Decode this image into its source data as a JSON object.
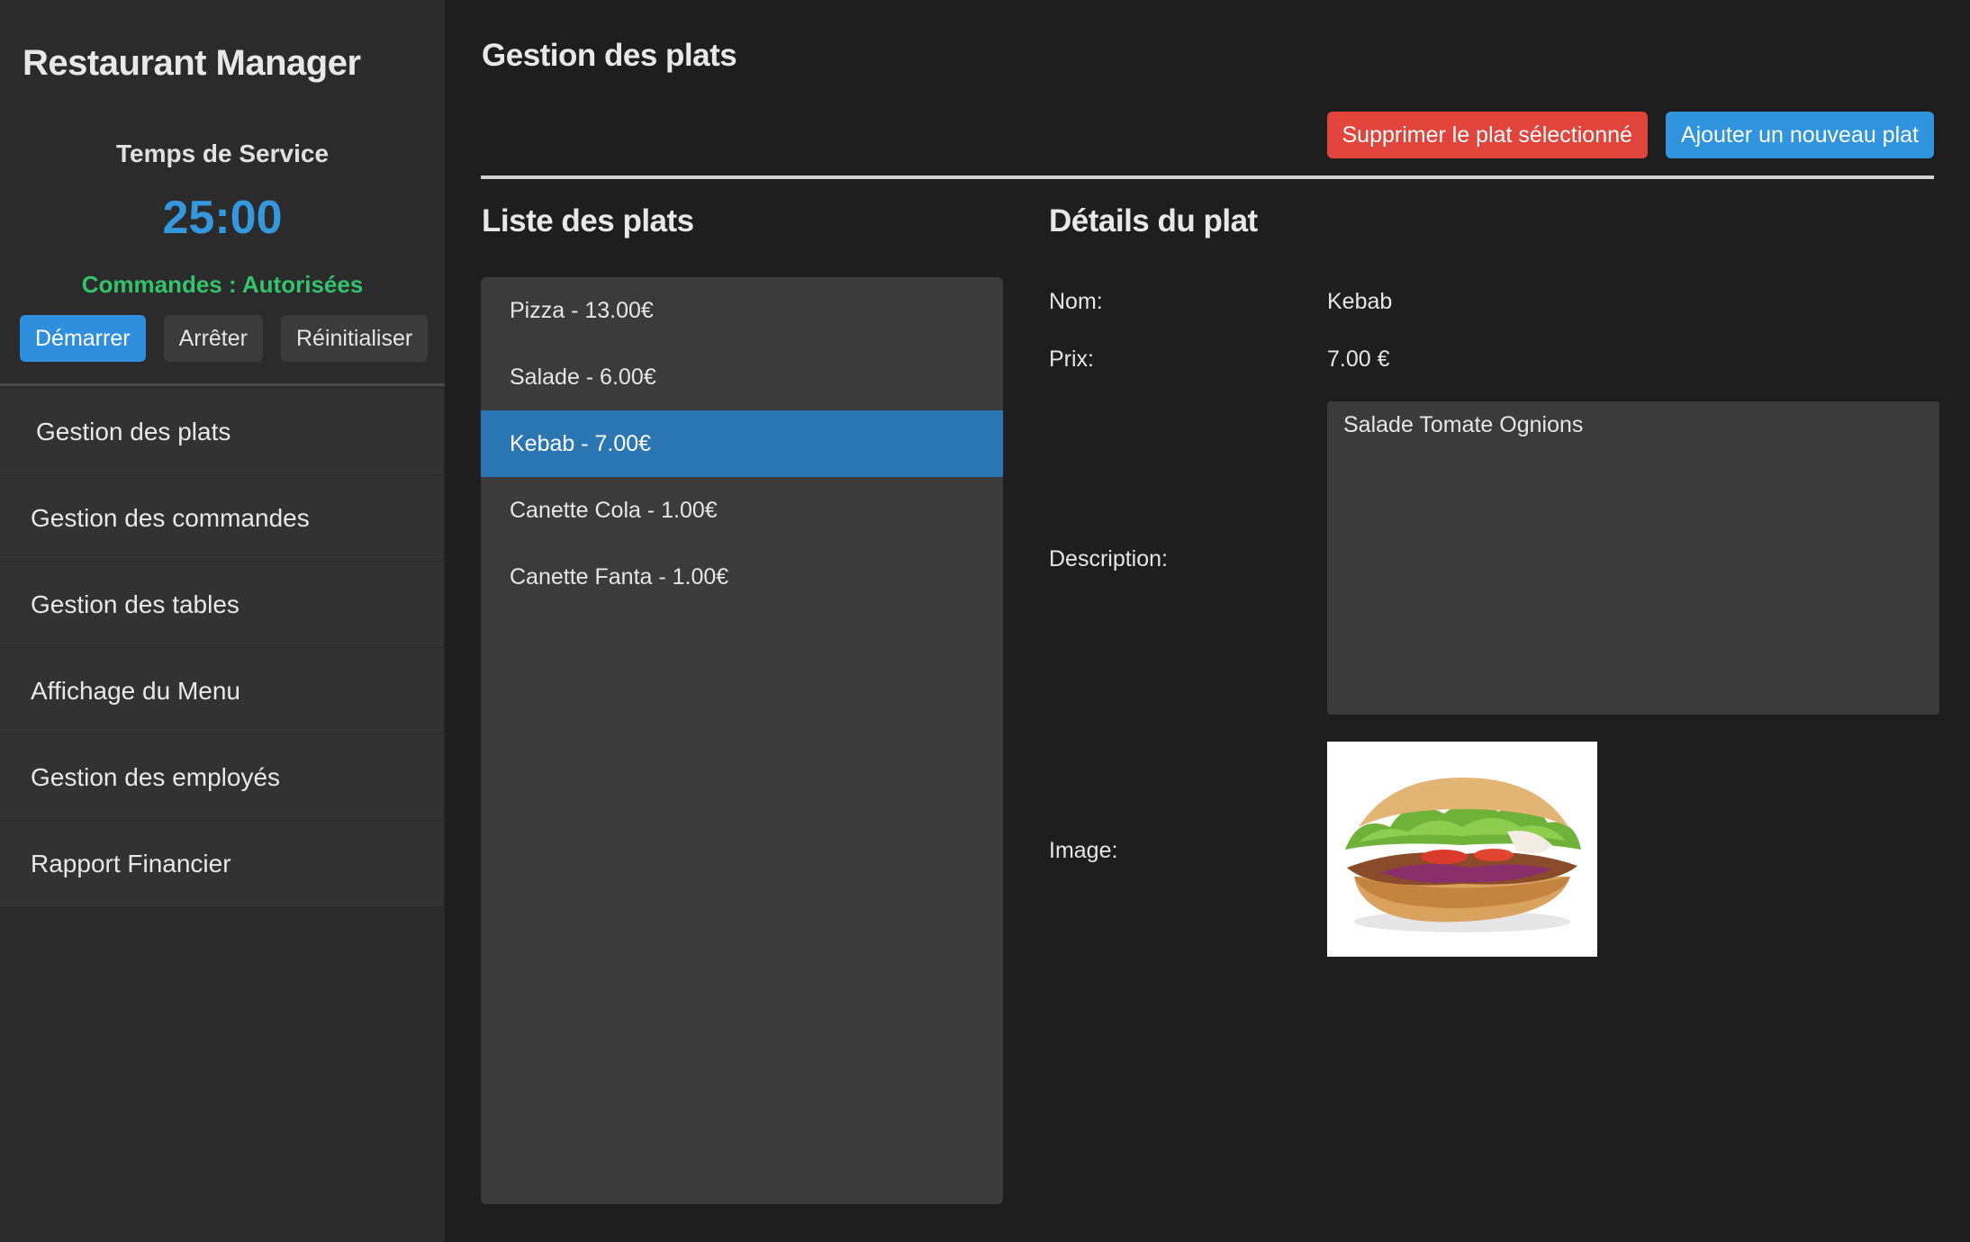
{
  "sidebar": {
    "app_title": "Restaurant Manager",
    "timer_label": "Temps de Service",
    "timer_value": "25:00",
    "orders_status": "Commandes : Autorisées",
    "buttons": {
      "start": "Démarrer",
      "stop": "Arrêter",
      "reset": "Réinitialiser"
    },
    "nav": [
      {
        "label": "Gestion des plats"
      },
      {
        "label": "Gestion des commandes"
      },
      {
        "label": "Gestion des tables"
      },
      {
        "label": "Affichage du Menu"
      },
      {
        "label": "Gestion des employés"
      },
      {
        "label": "Rapport Financier"
      }
    ]
  },
  "main": {
    "page_title": "Gestion des plats",
    "delete_button": "Supprimer le plat sélectionné",
    "add_button": "Ajouter un nouveau plat",
    "list_title": "Liste des plats",
    "details_title": "Détails du plat",
    "dishes": [
      {
        "label": "Pizza - 13.00€"
      },
      {
        "label": "Salade - 6.00€"
      },
      {
        "label": "Kebab - 7.00€"
      },
      {
        "label": "Canette Cola - 1.00€"
      },
      {
        "label": "Canette Fanta - 1.00€"
      }
    ],
    "selected_index": 2,
    "details": {
      "name_label": "Nom:",
      "name_value": "Kebab",
      "price_label": "Prix:",
      "price_value": "7.00 €",
      "description_label": "Description:",
      "description_value": "Salade Tomate Ognions",
      "image_label": "Image:"
    }
  },
  "colors": {
    "accent_blue": "#2f8fdc",
    "danger_red": "#e0443a",
    "status_green": "#33c36b",
    "selected_row": "#2a76b3"
  }
}
